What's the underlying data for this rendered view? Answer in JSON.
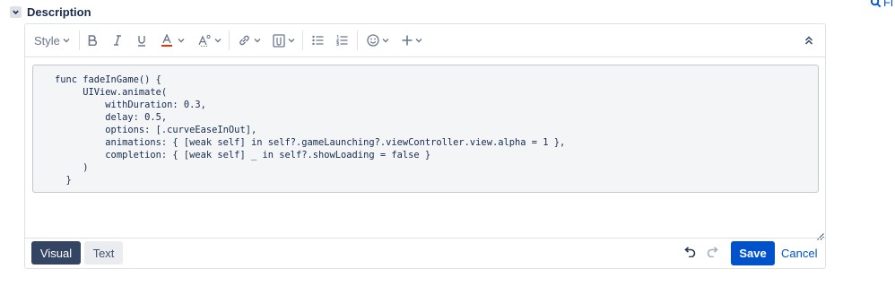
{
  "section": {
    "title": "Description"
  },
  "find_link": {
    "label": "Fi"
  },
  "toolbar": {
    "style_label": "Style",
    "items": [
      "bold-icon",
      "italic-icon",
      "underline-icon",
      "text-color-icon",
      "text-effects-icon",
      "link-icon",
      "attachment-icon",
      "bullet-list-icon",
      "numbered-list-icon",
      "emoji-icon",
      "insert-more-icon",
      "collapse-toolbar-icon"
    ],
    "text_color": "#de350b"
  },
  "code": {
    "lines": [
      "func fadeInGame() {",
      "     UIView.animate(",
      "         withDuration: 0.3,",
      "         delay: 0.5,",
      "         options: [.curveEaseInOut],",
      "         animations: { [weak self] in self?.gameLaunching?.viewController.view.alpha = 1 },",
      "         completion: { [weak self] _ in self?.showLoading = false }",
      "     )",
      "  }"
    ]
  },
  "modes": {
    "visual_label": "Visual",
    "text_label": "Text",
    "active": "Visual"
  },
  "actions": {
    "save_label": "Save",
    "cancel_label": "Cancel"
  },
  "colors": {
    "primary": "#0052cc",
    "active_mode": "#344563",
    "code_bg": "#f4f5f7"
  }
}
